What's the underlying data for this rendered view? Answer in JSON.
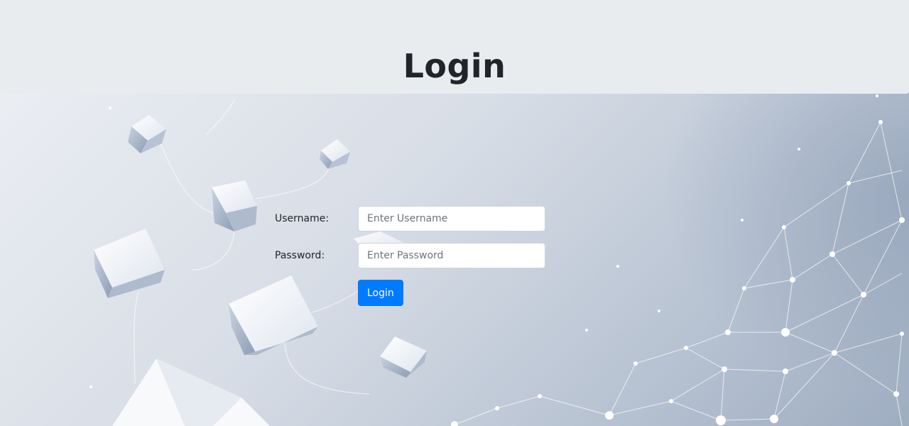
{
  "header": {
    "title": "Login"
  },
  "form": {
    "username_label": "Username:",
    "username_placeholder": "Enter Username",
    "password_label": "Password:",
    "password_placeholder": "Enter Password",
    "submit_label": "Login"
  },
  "colors": {
    "header_bg": "#e9ecef",
    "button_bg": "#007bff",
    "button_text": "#ffffff"
  }
}
